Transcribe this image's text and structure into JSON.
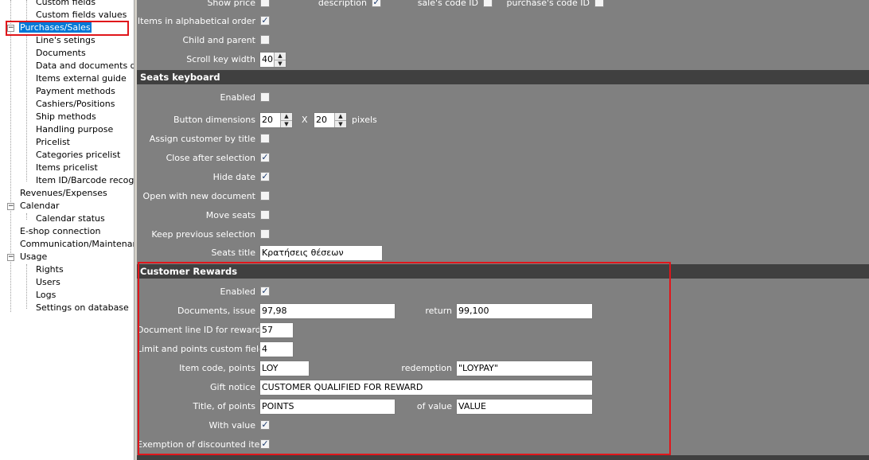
{
  "tree": {
    "items": [
      {
        "label": "Custom fields",
        "level": 2
      },
      {
        "label": "Custom fields values",
        "level": 2
      },
      {
        "label": "Purchases/Sales",
        "level": 1,
        "expanded": true,
        "selected": true
      },
      {
        "label": "Line's setings",
        "level": 2
      },
      {
        "label": "Documents",
        "level": 2
      },
      {
        "label": "Data and documents desi",
        "level": 2
      },
      {
        "label": "Items external guide",
        "level": 2
      },
      {
        "label": "Payment methods",
        "level": 2
      },
      {
        "label": "Cashiers/Positions",
        "level": 2
      },
      {
        "label": "Ship methods",
        "level": 2
      },
      {
        "label": "Handling purpose",
        "level": 2
      },
      {
        "label": "Pricelist",
        "level": 2
      },
      {
        "label": "Categories pricelist",
        "level": 2
      },
      {
        "label": "Items pricelist",
        "level": 2
      },
      {
        "label": "Item ID/Barcode recognize",
        "level": 2
      },
      {
        "label": "Revenues/Expenses",
        "level": 1
      },
      {
        "label": "Calendar",
        "level": 1,
        "expanded": true
      },
      {
        "label": "Calendar status",
        "level": 2
      },
      {
        "label": "E-shop connection",
        "level": 1
      },
      {
        "label": "Communication/Maintenance",
        "level": 1
      },
      {
        "label": "Usage",
        "level": 1,
        "expanded": true
      },
      {
        "label": "Rights",
        "level": 2
      },
      {
        "label": "Users",
        "level": 2
      },
      {
        "label": "Logs",
        "level": 2
      },
      {
        "label": "Settings on database",
        "level": 2
      }
    ]
  },
  "top": {
    "show_price_label": "Show price",
    "show_price": false,
    "description_label": "description",
    "description": true,
    "sales_code_label": "sale's code ID",
    "sales_code": false,
    "purchase_code_label": "purchase's code ID",
    "purchase_code": false,
    "alpha_label": "Items in alphabetical order",
    "alpha": true,
    "child_parent_label": "Child and parent",
    "child_parent": false,
    "scroll_label": "Scroll key width",
    "scroll_value": "40"
  },
  "seats": {
    "header": "Seats keyboard",
    "enabled_label": "Enabled",
    "enabled": false,
    "button_dim_label": "Button dimensions",
    "dim_w": "20",
    "dim_x": "X",
    "dim_h": "20",
    "pixels": "pixels",
    "assign_label": "Assign customer by title",
    "assign": false,
    "close_label": "Close after selection",
    "close": true,
    "hide_date_label": "Hide date",
    "hide_date": true,
    "open_new_label": "Open with new document",
    "open_new": false,
    "move_label": "Move seats",
    "move": false,
    "keep_label": "Keep previous selection",
    "keep": false,
    "title_label": "Seats title",
    "title_value": "Κρατήσεις θέσεων"
  },
  "rewards": {
    "header": "Customer Rewards",
    "enabled_label": "Enabled",
    "enabled": true,
    "docs_issue_label": "Documents, issue",
    "docs_issue_value": "97,98",
    "return_label": "return",
    "return_value": "99,100",
    "line_id_label": "Document line ID for rewards",
    "line_id_value": "57",
    "limit_label": "Limit and points custom field",
    "limit_value": "4",
    "item_code_label": "Item code, points",
    "item_code_value": "LOY",
    "redemption_label": "redemption",
    "redemption_value": "\"LOYPAY\"",
    "gift_label": "Gift notice",
    "gift_value": "CUSTOMER QUALIFIED FOR REWARD",
    "title_points_label": "Title, of points",
    "title_points_value": "POINTS",
    "of_value_label": "of value",
    "of_value_value": "VALUE",
    "with_value_label": "With value",
    "with_value": true,
    "exemption_label": "Exemption of discounted ite...",
    "exemption": true
  },
  "colors": {
    "panel_bg": "#808080",
    "section_header_bg": "#404040",
    "highlight_red": "#e0161b",
    "selected_blue": "#0078d7"
  }
}
